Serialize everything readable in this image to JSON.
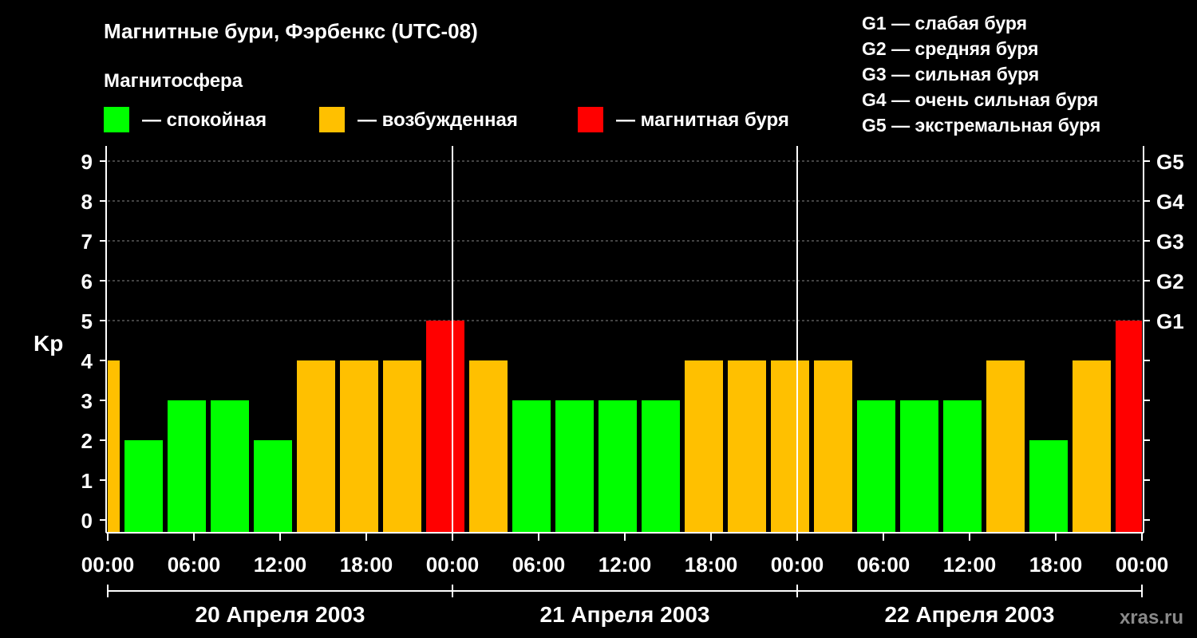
{
  "title": "Магнитные бури, Фэрбенкс (UTC-08)",
  "legend_title": "Магнитосфера",
  "legend": [
    {
      "label": "— спокойная",
      "color": "#00ff00"
    },
    {
      "label": "— возбужденная",
      "color": "#ffc000"
    },
    {
      "label": "— магнитная буря",
      "color": "#ff0000"
    }
  ],
  "storm_levels": [
    "G1 — слабая буря",
    "G2 — средняя буря",
    "G3 — сильная буря",
    "G4 — очень сильная буря",
    "G5 — экстремальная буря"
  ],
  "watermark": "xras.ru",
  "chart_data": {
    "type": "bar",
    "ylabel": "Kp",
    "ylim": [
      0,
      9
    ],
    "y_ticks": [
      "0",
      "1",
      "2",
      "3",
      "4",
      "5",
      "6",
      "7",
      "8",
      "9"
    ],
    "right_axis_ticks": [
      {
        "kp": 5,
        "label": "G1"
      },
      {
        "kp": 6,
        "label": "G2"
      },
      {
        "kp": 7,
        "label": "G3"
      },
      {
        "kp": 8,
        "label": "G4"
      },
      {
        "kp": 9,
        "label": "G5"
      }
    ],
    "x_tick_labels": [
      "00:00",
      "06:00",
      "12:00",
      "18:00",
      "00:00",
      "06:00",
      "12:00",
      "18:00",
      "00:00",
      "06:00",
      "12:00",
      "18:00",
      "00:00"
    ],
    "days": [
      "20 Апреля 2003",
      "21 Апреля 2003",
      "22 Апреля 2003"
    ],
    "x_range_hours": [
      0,
      72
    ],
    "grid": true,
    "first_bar_start_hour": -2,
    "bar_interval_hours": 3,
    "values": [
      4,
      2,
      3,
      3,
      2,
      4,
      4,
      4,
      5,
      4,
      3,
      3,
      3,
      3,
      4,
      4,
      4,
      4,
      3,
      3,
      3,
      4,
      2,
      4,
      5
    ],
    "thresholds": {
      "quiet_max": 3,
      "active": 4,
      "storm_min": 5
    },
    "colors": {
      "quiet": "#00ff00",
      "active": "#ffc000",
      "storm": "#ff0000"
    }
  }
}
